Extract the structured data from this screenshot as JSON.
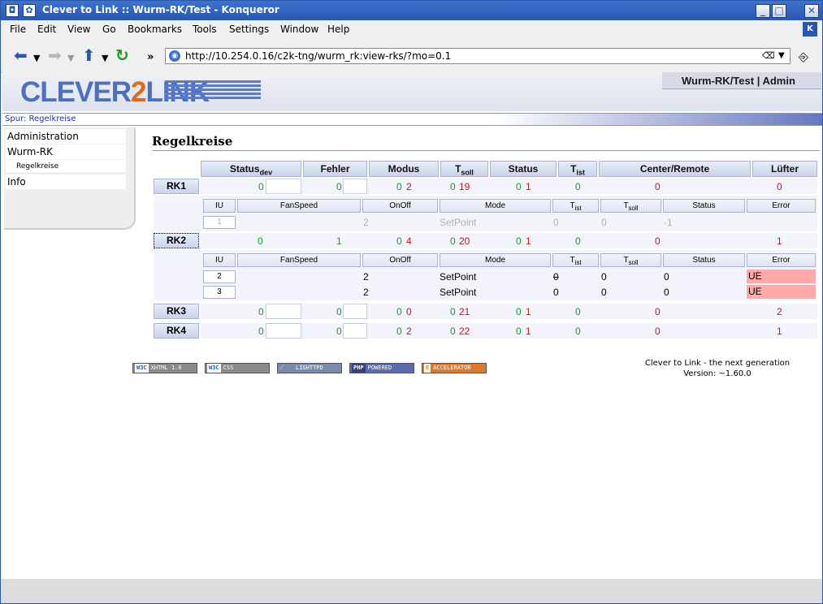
{
  "window": {
    "title": "Clever to Link :: Wurm-RK/Test - Konqueror"
  },
  "menu": [
    "File",
    "Edit",
    "View",
    "Go",
    "Bookmarks",
    "Tools",
    "Settings",
    "Window",
    "Help"
  ],
  "url": "http://10.254.0.16/c2k-tng/wurm_rk:view-rks/?mo=0.1",
  "header": {
    "logo_a": "CLEVER",
    "logo_b": "2",
    "logo_c": "LINK",
    "user_tab": "Wurm-RK/Test | Admin"
  },
  "breadcrumb": "Spur: Regelkreise",
  "sidebar": {
    "items": [
      "Administration",
      "Wurm-RK",
      "Regelkreise",
      "Info"
    ]
  },
  "page_title": "Regelkreise",
  "table": {
    "headers": {
      "status_main": "Status",
      "status_sub": "dev",
      "fehler": "Fehler",
      "modus": "Modus",
      "tsoll_main": "T",
      "tsoll_sub": "soll",
      "status": "Status",
      "tist_main": "T",
      "tist_sub": "ist",
      "center": "Center/Remote",
      "luefter": "Lüfter"
    },
    "sub_headers": {
      "iu": "IU",
      "fanspeed": "FanSpeed",
      "onoff": "OnOff",
      "mode": "Mode",
      "tist_main": "T",
      "tist_sub": "ist",
      "tsoll_main": "T",
      "tsoll_sub": "soll",
      "status": "Status",
      "error": "Error"
    },
    "rows": [
      {
        "label": "RK1",
        "status_dev": "0",
        "fehler": "0",
        "modus_a": "0",
        "modus_b": "2",
        "tsoll_a": "0",
        "tsoll_b": "19",
        "status_a": "0",
        "status_b": "1",
        "tist": "0",
        "center": "0",
        "luefter": "0"
      },
      {
        "label": "RK2",
        "status_dev": "0",
        "fehler": "1",
        "modus_a": "0",
        "modus_b": "4",
        "tsoll_a": "0",
        "tsoll_b": "20",
        "status_a": "0",
        "status_b": "1",
        "tist": "0",
        "center": "0",
        "luefter": "1"
      },
      {
        "label": "RK3",
        "status_dev": "0",
        "fehler": "0",
        "modus_a": "0",
        "modus_b": "0",
        "tsoll_a": "0",
        "tsoll_b": "21",
        "status_a": "0",
        "status_b": "1",
        "tist": "0",
        "center": "0",
        "luefter": "2"
      },
      {
        "label": "RK4",
        "status_dev": "0",
        "fehler": "0",
        "modus_a": "0",
        "modus_b": "2",
        "tsoll_a": "0",
        "tsoll_b": "22",
        "status_a": "0",
        "status_b": "1",
        "tist": "0",
        "center": "0",
        "luefter": "1"
      }
    ],
    "rk1_units": [
      {
        "iu": "1",
        "fanspeed": "2",
        "mode": "SetPoint",
        "tist": "0",
        "tsoll": "0",
        "status": "-1",
        "error": ""
      }
    ],
    "rk2_units": [
      {
        "iu": "2",
        "fanspeed": "2",
        "mode": "SetPoint",
        "tist": "0",
        "tsoll": "0",
        "status": "0",
        "error": "UE"
      },
      {
        "iu": "3",
        "fanspeed": "2",
        "mode": "SetPoint",
        "tist": "0",
        "tsoll": "0",
        "status": "0",
        "error": "UE"
      }
    ]
  },
  "badges": [
    {
      "a": "W3C",
      "b": "XHTML 1.0"
    },
    {
      "a": "W3C",
      "b": "CSS"
    },
    {
      "a": "",
      "b": "LIGHTTPD"
    },
    {
      "a": "PHP",
      "b": "POWERED"
    },
    {
      "a": "E",
      "b": "ACCELERATOR"
    }
  ],
  "footer": {
    "line1": "Clever to Link - the next generation",
    "line2": "Version: ~1.60.0"
  }
}
